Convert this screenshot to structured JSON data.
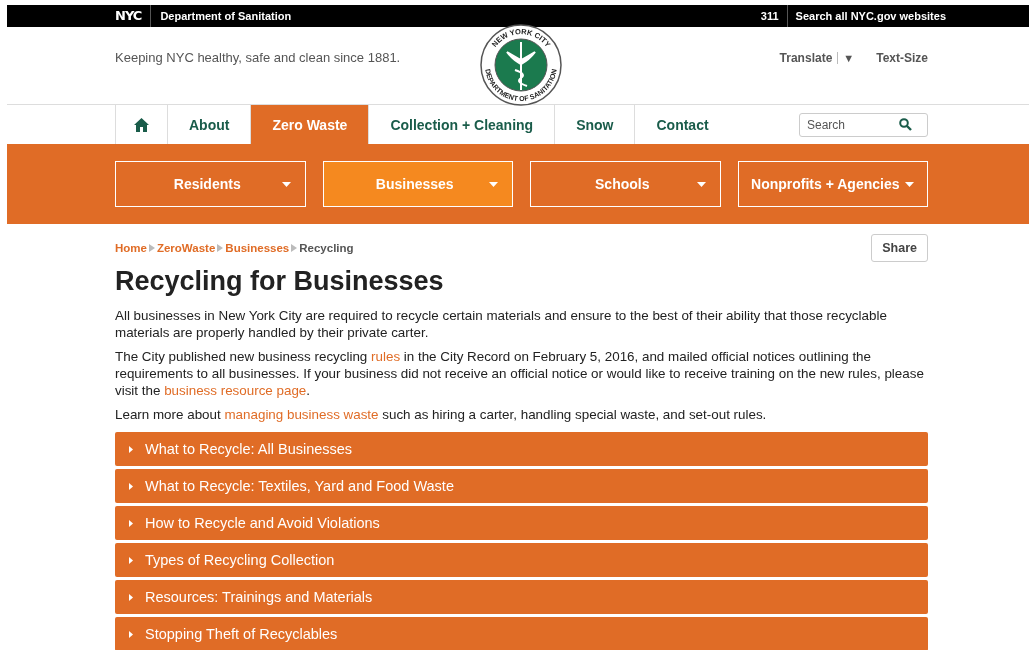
{
  "top_bar": {
    "logo": "NYC",
    "agency": "Department of Sanitation",
    "phone": "311",
    "search_link": "Search all NYC.gov websites"
  },
  "header": {
    "tagline": "Keeping NYC healthy, safe and clean since 1881.",
    "seal": {
      "top": "NEW YORK CITY",
      "bottom": "DEPARTMENT OF SANITATION"
    },
    "translate": "Translate",
    "translate_caret": "▼",
    "text_size": "Text-Size"
  },
  "nav": {
    "tabs": [
      {
        "kind": "home",
        "selected": false
      },
      {
        "label": "About",
        "selected": false
      },
      {
        "label": "Zero Waste",
        "selected": true
      },
      {
        "label": "Collection + Cleaning",
        "selected": false
      },
      {
        "label": "Snow",
        "selected": false
      },
      {
        "label": "Contact",
        "selected": false
      }
    ],
    "search": {
      "placeholder": "Search"
    }
  },
  "subnav": [
    {
      "label": "Residents",
      "selected": false
    },
    {
      "label": "Businesses",
      "selected": true
    },
    {
      "label": "Schools",
      "selected": false
    },
    {
      "label": "Nonprofits + Agencies",
      "selected": false
    }
  ],
  "breadcrumb": [
    {
      "label": "Home",
      "current": false
    },
    {
      "label": "ZeroWaste",
      "current": false
    },
    {
      "label": "Businesses",
      "current": false
    },
    {
      "label": "Recycling",
      "current": true
    }
  ],
  "share": "Share",
  "title": "Recycling for Businesses",
  "paragraphs": [
    [
      {
        "kind": "text",
        "text": "All businesses in New York City are required to recycle certain materials and ensure to the best of their ability that those recyclable materials are properly handled by their private carter."
      }
    ],
    [
      {
        "kind": "text",
        "text": "The City published new business recycling "
      },
      {
        "kind": "link",
        "text": "rules"
      },
      {
        "kind": "text",
        "text": " in the City Record on February 5, 2016, and mailed official notices outlining the requirements to all businesses. If your business did not receive an official notice or would like to receive training on the new rules, please visit the "
      },
      {
        "kind": "link",
        "text": "business resource page"
      },
      {
        "kind": "text",
        "text": "."
      }
    ],
    [
      {
        "kind": "text",
        "text": "Learn more about "
      },
      {
        "kind": "link",
        "text": "managing business waste"
      },
      {
        "kind": "text",
        "text": " such as hiring a carter, handling special waste, and set-out rules."
      }
    ]
  ],
  "accordion": [
    {
      "label": "What to Recycle: All Businesses",
      "expanded": false
    },
    {
      "label": "What to Recycle: Textiles, Yard and Food Waste",
      "expanded": false
    },
    {
      "label": "How to Recycle and Avoid Violations",
      "expanded": false
    },
    {
      "label": "Types of Recycling Collection",
      "expanded": false
    },
    {
      "label": "Resources: Trainings and Materials",
      "expanded": false
    },
    {
      "label": "Stopping Theft of Recyclables",
      "expanded": false
    }
  ]
}
